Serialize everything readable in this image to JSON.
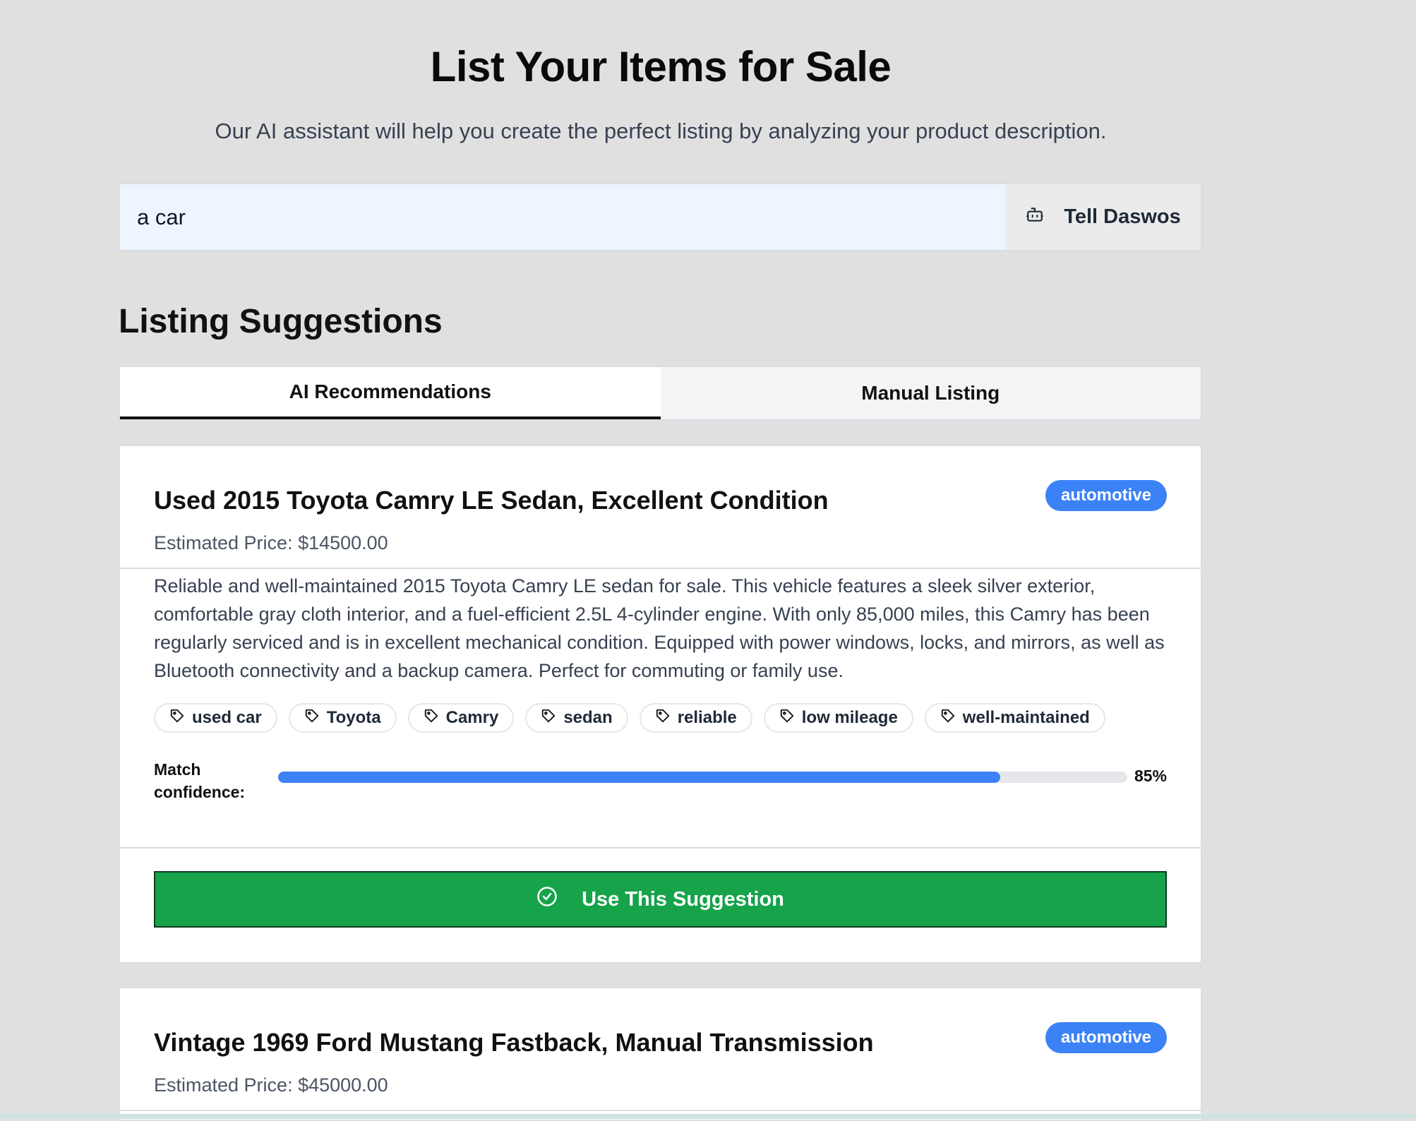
{
  "header": {
    "title": "List Your Items for Sale",
    "subtitle": "Our AI assistant will help you create the perfect listing by analyzing your product description."
  },
  "prompt": {
    "value": "a car",
    "button_label": "Tell Daswos",
    "button_icon": "robot-icon"
  },
  "suggestions_section": {
    "title": "Listing Suggestions",
    "tabs": [
      {
        "label": "AI Recommendations",
        "active": true
      },
      {
        "label": "Manual Listing",
        "active": false
      }
    ]
  },
  "listings": [
    {
      "title": "Used 2015 Toyota Camry LE Sedan, Excellent Condition",
      "category": "automotive",
      "price": "Estimated Price: $14500.00",
      "description": "Reliable and well-maintained 2015 Toyota Camry LE sedan for sale. This vehicle features a sleek silver exterior, comfortable gray cloth interior, and a fuel-efficient 2.5L 4-cylinder engine. With only 85,000 miles, this Camry has been regularly serviced and is in excellent mechanical condition. Equipped with power windows, locks, and mirrors, as well as Bluetooth connectivity and a backup camera. Perfect for commuting or family use.",
      "tags": [
        "used car",
        "Toyota",
        "Camry",
        "sedan",
        "reliable",
        "low mileage",
        "well-maintained"
      ],
      "confidence_label": "Match confidence:",
      "confidence_value": "85%",
      "confidence_fraction": 0.85,
      "action_label": "Use This Suggestion"
    },
    {
      "title": "Vintage 1969 Ford Mustang Fastback, Manual Transmission",
      "category": "automotive",
      "price": "Estimated Price: $45000.00"
    }
  ],
  "colors": {
    "accent_blue": "#3b82f6",
    "action_green": "#16a34a",
    "page_bg": "#e0e0e0"
  }
}
